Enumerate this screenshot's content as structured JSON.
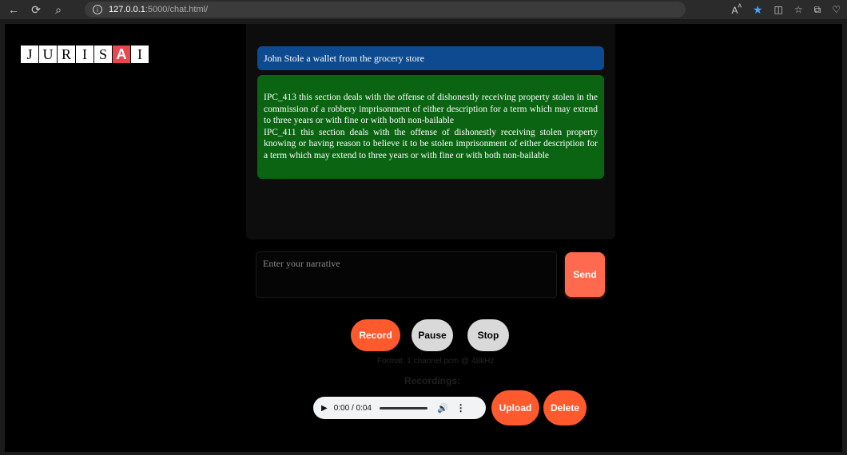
{
  "browser": {
    "url_host": "127.0.0.1",
    "url_rest": ":5000/chat.html/"
  },
  "logo": {
    "letters": [
      "J",
      "U",
      "R",
      "I",
      "S",
      "A",
      "I"
    ]
  },
  "chat": {
    "user_message": "John Stole a wallet from the grocery store",
    "bot_message_1": "IPC_413 this section deals with the offense of dishonestly receiving property stolen in the commission of a robbery imprisonment of either description for a term which may extend to three years or with fine or with both non-bailable",
    "bot_message_2": "IPC_411 this section deals with the offense of dishonestly receiving stolen property knowing or having reason to believe it to be stolen imprisonment of either description for a term which may extend to three years or with fine or with both non-bailable"
  },
  "input": {
    "placeholder": "Enter your narrative",
    "send_label": "Send"
  },
  "recorder": {
    "record_label": "Record",
    "pause_label": "Pause",
    "stop_label": "Stop",
    "format_text": "Format: 1 channel pcm @ 48kHz",
    "recordings_label": "Recordings:"
  },
  "player": {
    "time": "0:00 / 0:04",
    "upload_label": "Upload",
    "delete_label": "Delete"
  },
  "colors": {
    "user_bubble": "#0d4a8f",
    "bot_bubble": "#0b6412",
    "accent": "#ff5a2e"
  }
}
